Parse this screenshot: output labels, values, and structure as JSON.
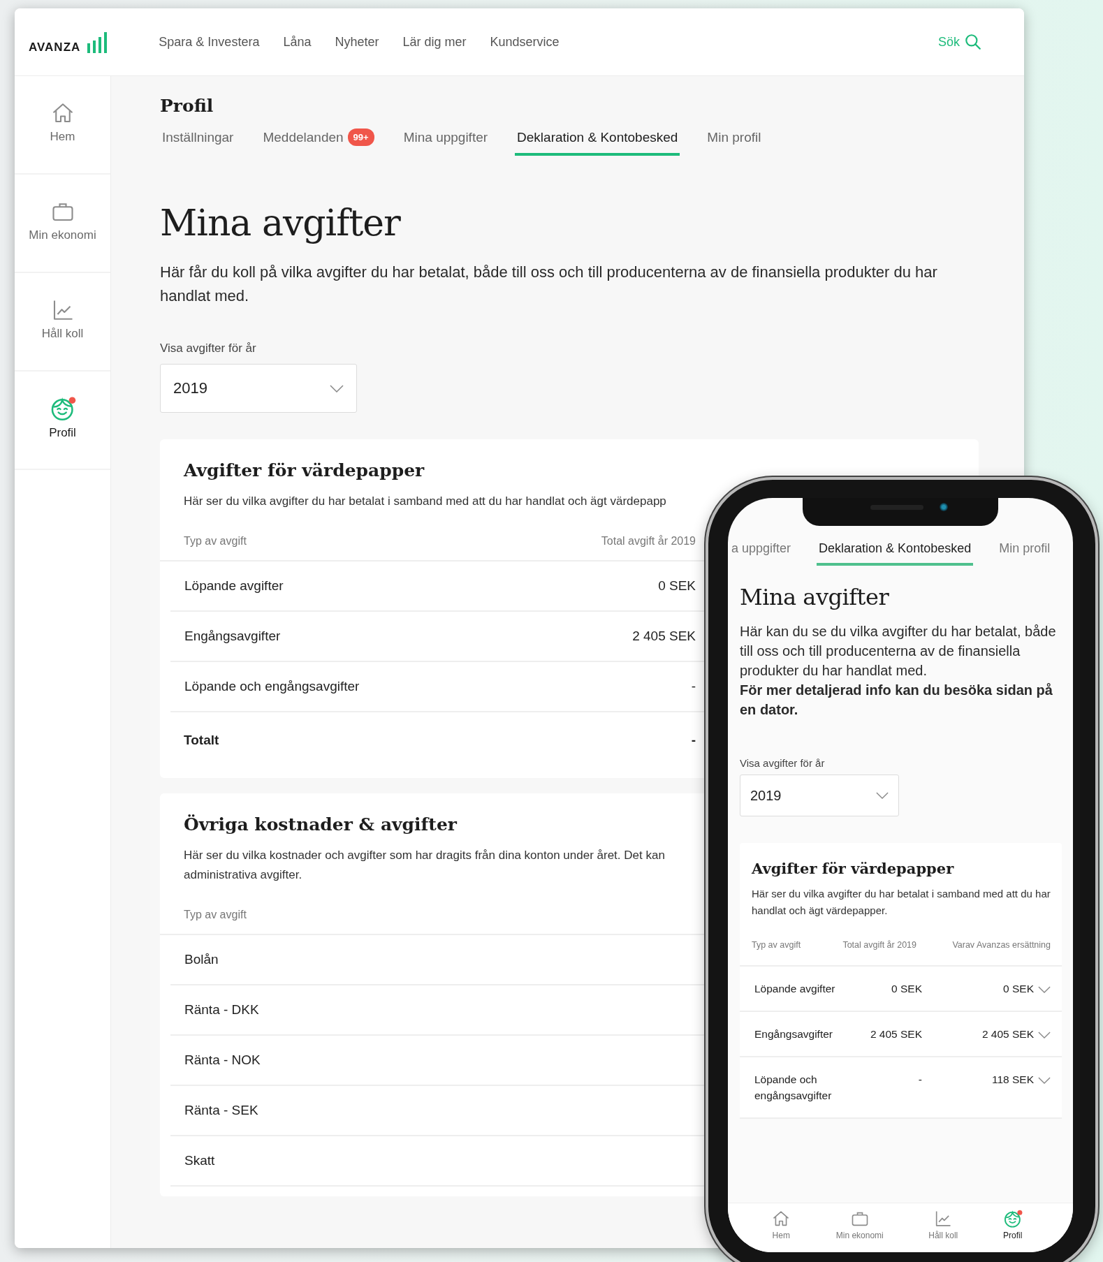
{
  "header": {
    "logo": "AVANZA",
    "nav": [
      {
        "label": "Spara & Investera"
      },
      {
        "label": "Låna"
      },
      {
        "label": "Nyheter"
      },
      {
        "label": "Lär dig mer"
      },
      {
        "label": "Kundservice"
      }
    ],
    "search": "Sök"
  },
  "sidebar": {
    "items": [
      {
        "label": "Hem",
        "selected": false
      },
      {
        "label": "Min ekonomi",
        "selected": false
      },
      {
        "label": "Håll koll",
        "selected": false
      },
      {
        "label": "Profil",
        "selected": true
      }
    ]
  },
  "page": {
    "title": "Profil",
    "tabs": [
      {
        "label": "Inställningar",
        "selected": false
      },
      {
        "label": "Meddelanden",
        "badge": "99+",
        "selected": false
      },
      {
        "label": "Mina uppgifter",
        "selected": false
      },
      {
        "label": "Deklaration & Kontobesked",
        "selected": true
      },
      {
        "label": "Min profil",
        "selected": false
      }
    ],
    "heading": "Mina avgifter",
    "intro": "Här får du koll på vilka avgifter du har betalat, både till oss och till producenterna av de finansiella produkter du har handlat med.",
    "year_label": "Visa avgifter för år",
    "year": "2019",
    "sections": [
      {
        "title": "Avgifter för värdepapper",
        "description_lines": [
          "Här ser du vilka avgifter du har betalat i samband med att du har handlat och ägt värdepapp"
        ],
        "columns": [
          "Typ av avgift",
          "Total avgift år 2019"
        ],
        "rows": [
          {
            "kind": "fee",
            "label": "Löpande avgifter",
            "value": "0 SEK"
          },
          {
            "kind": "fee",
            "label": "Engångsavgifter",
            "value": "2 405 SEK"
          },
          {
            "kind": "fee",
            "label": "Löpande och engångsavgifter",
            "value": "-"
          },
          {
            "kind": "total",
            "label": "Totalt",
            "value": "-"
          }
        ]
      },
      {
        "title": "Övriga kostnader & avgifter",
        "description_lines": [
          "Här ser du vilka kostnader och avgifter som har dragits från dina konton under året. Det kan",
          "administrativa avgifter."
        ],
        "columns": [
          "Typ av avgift"
        ],
        "rows": [
          {
            "kind": "fee",
            "label": "Bolån"
          },
          {
            "kind": "fee",
            "label": "Ränta - DKK"
          },
          {
            "kind": "fee",
            "label": "Ränta - NOK"
          },
          {
            "kind": "fee",
            "label": "Ränta - SEK"
          },
          {
            "kind": "fee",
            "label": "Skatt"
          }
        ]
      }
    ]
  },
  "phone": {
    "tabs": [
      {
        "label": "a uppgifter",
        "selected": false
      },
      {
        "label": "Deklaration & Kontobesked",
        "selected": true
      },
      {
        "label": "Min profil",
        "selected": false
      }
    ],
    "heading": "Mina avgifter",
    "intro": "Här kan du se du vilka avgifter du har betalat, både till oss och till producenterna av de finansiella produkter du har handlat med. **För mer detaljerad info kan du besöka sidan på en dator.**",
    "year_label": "Visa avgifter för år",
    "year": "2019",
    "section": {
      "title": "Avgifter för värdepapper",
      "description": "Här ser du vilka avgifter du har betalat i samband med att du har handlat och ägt värdepapper.",
      "columns": [
        "Typ av avgift",
        "Total avgift år 2019",
        "Varav Avanzas ersättning"
      ],
      "rows": [
        {
          "label": "Löpande avgifter",
          "total": "0 SEK",
          "commission": "0 SEK"
        },
        {
          "label": "Engångsavgifter",
          "total": "2 405 SEK",
          "commission": "2 405 SEK"
        },
        {
          "label": "Löpande och engångsavgifter",
          "total": "-",
          "commission": "118 SEK"
        }
      ]
    },
    "nav": {
      "items": [
        {
          "label": "Hem",
          "selected": false
        },
        {
          "label": "Min ekonomi",
          "selected": false
        },
        {
          "label": "Håll koll",
          "selected": false
        },
        {
          "label": "Profil",
          "selected": true
        }
      ]
    }
  }
}
